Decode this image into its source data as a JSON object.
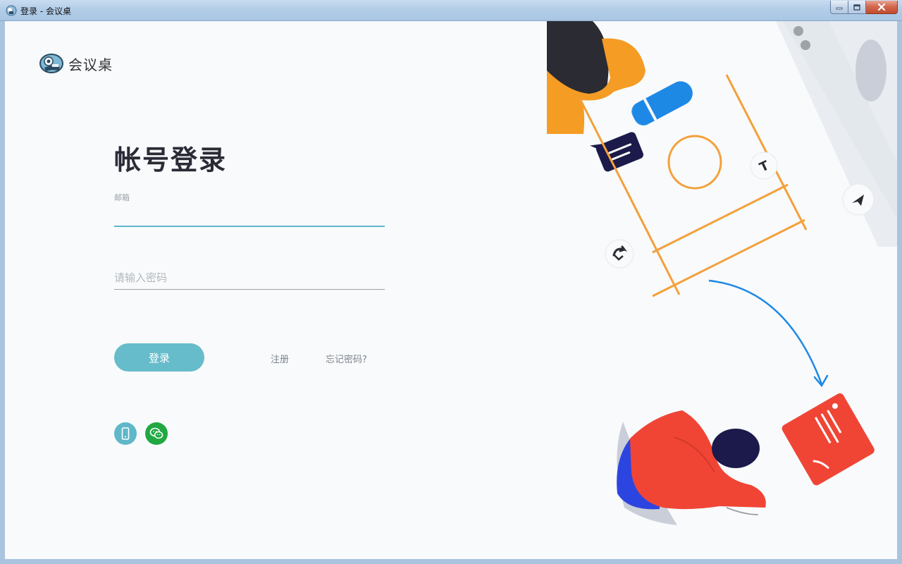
{
  "window": {
    "title": "登录 - 会议桌"
  },
  "app": {
    "logo_text": "会议桌"
  },
  "form": {
    "title": "帐号登录",
    "email_label": "邮箱",
    "email_value": "",
    "password_placeholder": "请输入密码",
    "login_label": "登录",
    "register_label": "注册",
    "forgot_label": "忘记密码?"
  },
  "social": {
    "items": [
      {
        "icon": "phone-icon",
        "color": "#5fb7c9"
      },
      {
        "icon": "wechat-icon",
        "color": "#21a843"
      }
    ]
  },
  "colors": {
    "accent": "#5bb7c9",
    "button": "#67bccb",
    "wechat": "#21a843",
    "illustration_red": "#f04535",
    "illustration_orange": "#f4a03a",
    "illustration_blue": "#1e88e5",
    "illustration_navy": "#1b1a4a"
  }
}
